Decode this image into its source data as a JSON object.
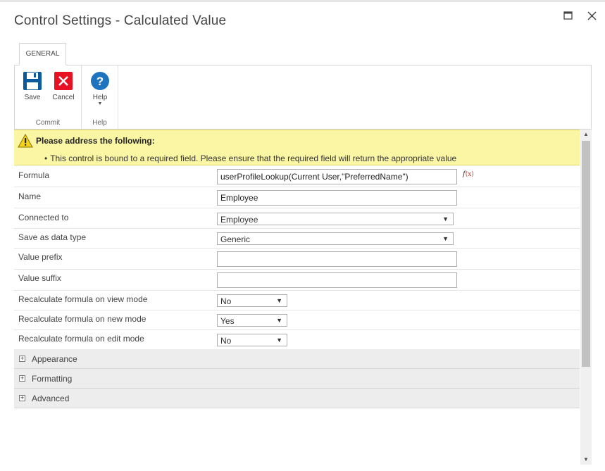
{
  "dialog": {
    "title": "Control Settings - Calculated Value"
  },
  "ribbon": {
    "tab": "GENERAL",
    "groups": {
      "commit": {
        "label": "Commit",
        "save": "Save",
        "cancel": "Cancel"
      },
      "help": {
        "label": "Help",
        "help": "Help"
      }
    }
  },
  "warning": {
    "title": "Please address the following:",
    "message": "This control is bound to a required field. Please ensure that the required field will return the appropriate value"
  },
  "form": {
    "formula": {
      "label": "Formula",
      "value": "userProfileLookup(Current User,\"PreferredName\")",
      "fx": "f",
      "fx_inner": "(x)"
    },
    "name": {
      "label": "Name",
      "value": "Employee"
    },
    "connected_to": {
      "label": "Connected to",
      "value": "Employee"
    },
    "data_type": {
      "label": "Save as data type",
      "value": "Generic"
    },
    "value_prefix": {
      "label": "Value prefix",
      "value": ""
    },
    "value_suffix": {
      "label": "Value suffix",
      "value": ""
    },
    "recalc_view": {
      "label": "Recalculate formula on view mode",
      "value": "No"
    },
    "recalc_new": {
      "label": "Recalculate formula on new mode",
      "value": "Yes"
    },
    "recalc_edit": {
      "label": "Recalculate formula on edit mode",
      "value": "No"
    }
  },
  "sections": {
    "appearance": "Appearance",
    "formatting": "Formatting",
    "advanced": "Advanced"
  },
  "icons": {
    "save": "save-icon",
    "cancel": "cancel-icon",
    "help": "help-icon",
    "warning": "warning-icon",
    "maximize": "maximize-icon",
    "close": "close-icon",
    "expand": "plus-icon",
    "dropdown": "chevron-down-icon"
  },
  "colors": {
    "save_blue": "#0a5a9c",
    "cancel_red": "#e81123",
    "help_blue": "#1e73be",
    "warning_bg": "#fbf6a4"
  }
}
